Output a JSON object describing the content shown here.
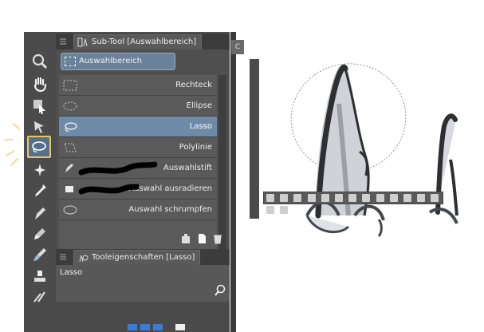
{
  "subtool_panel": {
    "tab_label": "Sub-Tool [Auswahlbereich]",
    "group_button_label": "Auswahlbereich",
    "items": [
      {
        "label": "Rechteck",
        "icon": "rect-dashed-icon",
        "selected": false
      },
      {
        "label": "Ellipse",
        "icon": "ellipse-dashed-icon",
        "selected": false
      },
      {
        "label": "Lasso",
        "icon": "lasso-icon",
        "selected": true
      },
      {
        "label": "Polylinie",
        "icon": "polyline-icon",
        "selected": false
      },
      {
        "label": "Auswahlstift",
        "icon": "selection-pen-icon",
        "selected": false
      },
      {
        "label": "Auswahl ausradieren",
        "icon": "selection-eraser-icon",
        "selected": false
      },
      {
        "label": "Auswahl schrumpfen",
        "icon": "shrink-selection-icon",
        "selected": false
      }
    ]
  },
  "properties_panel": {
    "tab_label": "Tooleigenschaften [Lasso]",
    "title": "Lasso"
  },
  "canvas_edge_button": "C",
  "colors": {
    "accent_selected": "#6f8aa6",
    "highlight": "#e8c66a",
    "panel_bg": "#4f4f4f"
  }
}
